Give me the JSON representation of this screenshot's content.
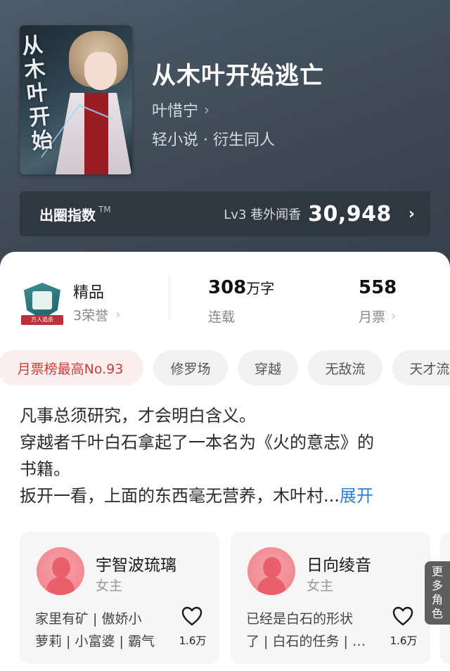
{
  "book": {
    "title": "从木叶开始逃亡",
    "author": "叶惜宁",
    "genre": "轻小说 · 衍生同人",
    "cover_title": "从木叶开始"
  },
  "index_bar": {
    "label": "出圈指数",
    "tm": "TM",
    "level": "Lv3 巷外闻香",
    "value": "30,948"
  },
  "stats": {
    "quality": "精品",
    "honor": "3荣誉",
    "badge_text": "万人追杀",
    "words_num": "308",
    "words_unit": "万字",
    "status": "连载",
    "votes": "558",
    "votes_label": "月票"
  },
  "tags": [
    "月票榜最高No.93",
    "修罗场",
    "穿越",
    "无敌流",
    "天才流"
  ],
  "intro": {
    "lines": [
      "凡事总须研究，才会明白含义。",
      "穿越者千叶白石拿起了一本名为《火的意志》的",
      "书籍。",
      "扳开一看，上面的东西毫无营养，木叶村..."
    ],
    "expand": "展开"
  },
  "characters": [
    {
      "name": "宇智波琉璃",
      "role": "女主",
      "desc1": "家里有矿 | 傲娇小",
      "desc2": "萝莉 | 小富婆 | 霸气",
      "likes": "1.6万"
    },
    {
      "name": "日向绫音",
      "role": "女主",
      "desc1": "已经是白石的形状",
      "desc2": "了 | 白石的任务 | …",
      "likes": "1.6万"
    }
  ],
  "more_roles": "更多角色",
  "colors": {
    "hero_bg": "#3e4955",
    "index_bar_bg": "#2f3841",
    "hot_tag_text": "#d23a3a",
    "expand_link": "#2d7ed6"
  }
}
